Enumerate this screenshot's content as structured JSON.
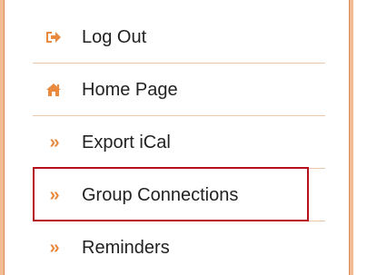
{
  "menu": {
    "items": [
      {
        "label": "Log Out",
        "icon": "sign-out-icon"
      },
      {
        "label": "Home Page",
        "icon": "home-icon"
      },
      {
        "label": "Export iCal",
        "icon": "double-chevron-right-icon"
      },
      {
        "label": "Group Connections",
        "icon": "double-chevron-right-icon"
      },
      {
        "label": "Reminders",
        "icon": "double-chevron-right-icon"
      }
    ],
    "chevron_glyph": "»"
  },
  "colors": {
    "accent": "#e98a3f",
    "frame_edge": "#f2bd93",
    "separator": "#edc8a8",
    "highlight_border": "#b7101c",
    "text": "#222222"
  }
}
